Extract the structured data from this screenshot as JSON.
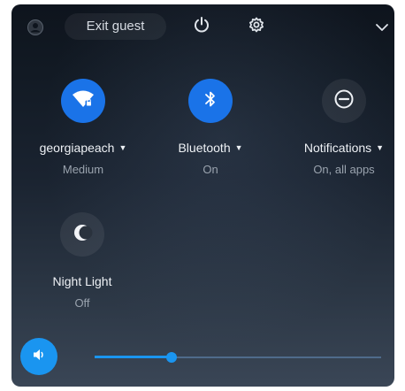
{
  "top_bar": {
    "exit_guest_label": "Exit guest",
    "avatar_icon": "user-avatar-icon",
    "power_icon": "power-icon",
    "settings_icon": "gear-icon",
    "collapse_icon": "chevron-down-icon"
  },
  "tiles": [
    {
      "label": "georgiapeach",
      "sublabel": "Medium",
      "icon": "wifi-locked-icon",
      "active": true,
      "has_dropdown": true
    },
    {
      "label": "Bluetooth",
      "sublabel": "On",
      "icon": "bluetooth-icon",
      "active": true,
      "has_dropdown": true
    },
    {
      "label": "Notifications",
      "sublabel": "On, all apps",
      "icon": "do-not-disturb-icon",
      "active": false,
      "has_dropdown": true
    },
    {
      "label": "Night Light",
      "sublabel": "Off",
      "icon": "night-light-icon",
      "active": false,
      "has_dropdown": false
    }
  ],
  "volume": {
    "icon": "speaker-icon",
    "level": 0.27
  },
  "colors": {
    "accent": "#1a73e8",
    "volume_accent": "#1a95f0",
    "panel_bg": "#121a24"
  }
}
